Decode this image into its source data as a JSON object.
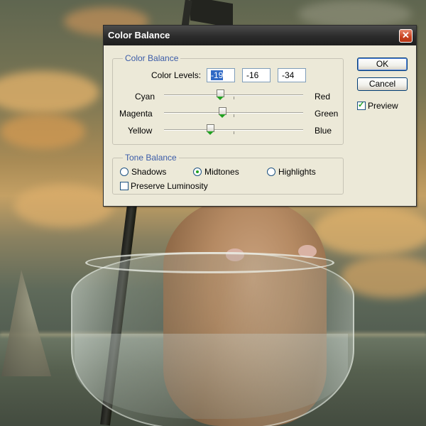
{
  "dialog": {
    "title": "Color Balance",
    "close_glyph": "✕",
    "color_balance_group": "Color Balance",
    "color_levels_label": "Color Levels:",
    "levels": [
      "-19",
      "-16",
      "-34"
    ],
    "sliders": [
      {
        "left": "Cyan",
        "right": "Red",
        "value": -19
      },
      {
        "left": "Magenta",
        "right": "Green",
        "value": -16
      },
      {
        "left": "Yellow",
        "right": "Blue",
        "value": -34
      }
    ],
    "slider_range": [
      -100,
      100
    ],
    "tone_balance_group": "Tone Balance",
    "tones": [
      {
        "label": "Shadows",
        "selected": false
      },
      {
        "label": "Midtones",
        "selected": true
      },
      {
        "label": "Highlights",
        "selected": false
      }
    ],
    "preserve_luminosity": {
      "label": "Preserve Luminosity",
      "checked": false
    },
    "buttons": {
      "ok": "OK",
      "cancel": "Cancel"
    },
    "preview": {
      "label": "Preview",
      "checked": true
    }
  },
  "colors": {
    "accent_blue": "#3b5ca8",
    "thumb_green": "#21a121",
    "close_red": "#c7411f"
  }
}
